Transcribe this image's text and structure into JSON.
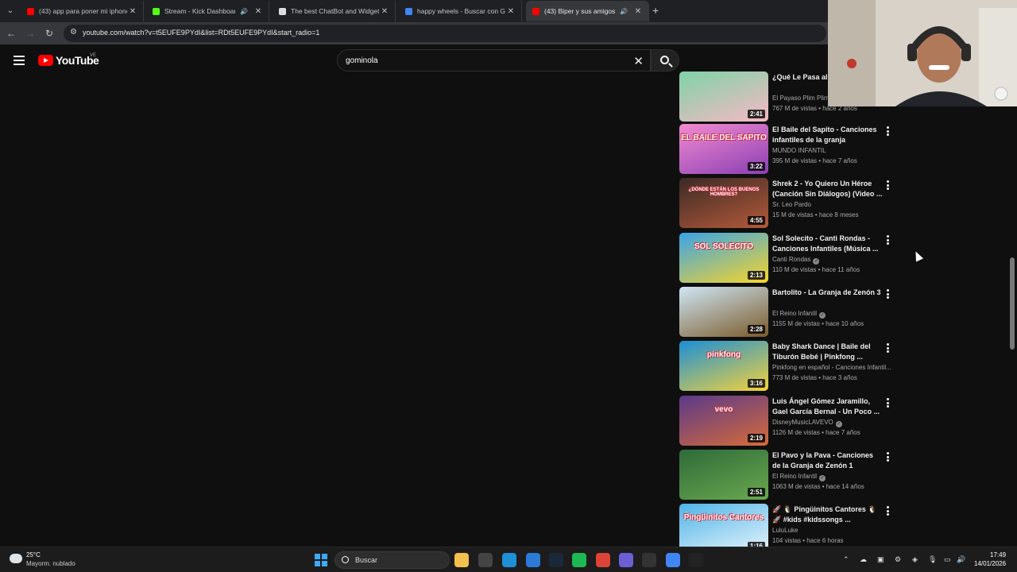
{
  "browser": {
    "tabs": [
      {
        "title": "(43) app para poner mi iphone",
        "favicon_color": "#ff0000",
        "audio": false,
        "active": false
      },
      {
        "title": "Stream - Kick Dashboard",
        "favicon_color": "#53fc18",
        "audio": true,
        "active": false
      },
      {
        "title": "The best ChatBot and Widgets",
        "favicon_color": "#dddddd",
        "audio": false,
        "active": false
      },
      {
        "title": "happy wheels - Buscar con Goo",
        "favicon_color": "#4285f4",
        "audio": false,
        "active": false
      },
      {
        "title": "(43) Biper y sus amigos - El",
        "favicon_color": "#ff0000",
        "audio": true,
        "active": true
      }
    ],
    "new_tab_label": "+",
    "url": "youtube.com/watch?v=t5EUFE9PYdI&list=RDt5EUFE9PYdI&start_radio=1"
  },
  "youtube": {
    "logo_text": "YouTube",
    "country_code": "VE",
    "search_value": "gominola"
  },
  "playlist": [
    {
      "title": "¿Qué Le Pasa al ... Canciones",
      "channel": "El Payaso Plim Plim",
      "meta": "767 M de vistas • hace 2 años",
      "duration": "2:41",
      "verified": false,
      "thumb_colors": [
        "#7fd3a8",
        "#f6b8c4"
      ],
      "thumb_text": ""
    },
    {
      "title": "El Baile del Sapito - Canciones infantiles  de la granja",
      "channel": "MUNDO INFANTIL",
      "meta": "395 M de vistas • hace 7 años",
      "duration": "3:22",
      "verified": false,
      "thumb_colors": [
        "#f28bd1",
        "#8a3fb3"
      ],
      "thumb_text": "EL BAILE DEL SAPITO"
    },
    {
      "title": "Shrek 2 - Yo Quiero Un Héroe (Canción Sin Diálogos) (Video ...",
      "channel": "Sr. Leo Pardo",
      "meta": "15 M de vistas • hace 8 meses",
      "duration": "4:55",
      "verified": false,
      "thumb_colors": [
        "#3b2a26",
        "#b45a3a"
      ],
      "thumb_text": "¿DÓNDE ESTÁN LOS BUENOS HOMBRES?"
    },
    {
      "title": "Sol Solecito - Canti Rondas - Canciones Infantiles (Música ...",
      "channel": "Canti Rondas",
      "meta": "110 M de vistas • hace 11 años",
      "duration": "2:13",
      "verified": true,
      "thumb_colors": [
        "#3aa3e8",
        "#f7d52a"
      ],
      "thumb_text": "SOL SOLECITO"
    },
    {
      "title": "Bartolito - La Granja de Zenón 3",
      "channel": "El Reino Infantil",
      "meta": "1155 M de vistas • hace 10 años",
      "duration": "2:28",
      "verified": true,
      "thumb_colors": [
        "#cfe6f5",
        "#7a5a2a"
      ],
      "thumb_text": ""
    },
    {
      "title": "Baby Shark Dance | Baile del Tiburón Bebé | Pinkfong ...",
      "channel": "Pinkfong en español - Canciones Infantil...",
      "meta": "773 M de vistas • hace 3 años",
      "duration": "3:16",
      "verified": false,
      "thumb_colors": [
        "#1b8fd6",
        "#f5d23b"
      ],
      "thumb_text": "pinkfong"
    },
    {
      "title": "Luis Ángel Gómez Jaramillo, Gael García Bernal - Un Poco ...",
      "channel": "DisneyMusicLAVEVO",
      "meta": "1126 M de vistas • hace 7 años",
      "duration": "2:19",
      "verified": true,
      "thumb_colors": [
        "#5a3a8a",
        "#d66b3a"
      ],
      "thumb_text": "vevo"
    },
    {
      "title": "El Pavo y la Pava - Canciones de la Granja de Zenón 1",
      "channel": "El Reino Infantil",
      "meta": "1063 M de vistas • hace 14 años",
      "duration": "2:51",
      "verified": true,
      "thumb_colors": [
        "#2f6b3a",
        "#6aa84f"
      ],
      "thumb_text": ""
    },
    {
      "title": "🚀 🐧 Pingüinitos Cantores 🐧 🚀 #kids #kidssongs ...",
      "channel": "LuluLuke",
      "meta": "104 vistas • hace 6 horas",
      "duration": "1:16",
      "verified": false,
      "thumb_colors": [
        "#4fb4e8",
        "#e8f4fb"
      ],
      "thumb_text": "Pingüinitos Cantores"
    }
  ],
  "taskbar": {
    "temperature": "25°C",
    "weather": "Mayorm. nublado",
    "search_label": "Buscar",
    "time": "17:49",
    "date": "14/01/2026",
    "apps": [
      {
        "name": "file-explorer",
        "color": "#f2c14e"
      },
      {
        "name": "task-view",
        "color": "#444444"
      },
      {
        "name": "edge",
        "color": "#1f8fd6"
      },
      {
        "name": "store",
        "color": "#2a7ad6"
      },
      {
        "name": "steam",
        "color": "#1b2838"
      },
      {
        "name": "spotify",
        "color": "#1db954"
      },
      {
        "name": "chrome",
        "color": "#db4437"
      },
      {
        "name": "obs",
        "color": "#6b5fd6"
      },
      {
        "name": "app",
        "color": "#333333"
      },
      {
        "name": "chrome-alt",
        "color": "#4285f4"
      },
      {
        "name": "epic",
        "color": "#222222"
      }
    ]
  }
}
